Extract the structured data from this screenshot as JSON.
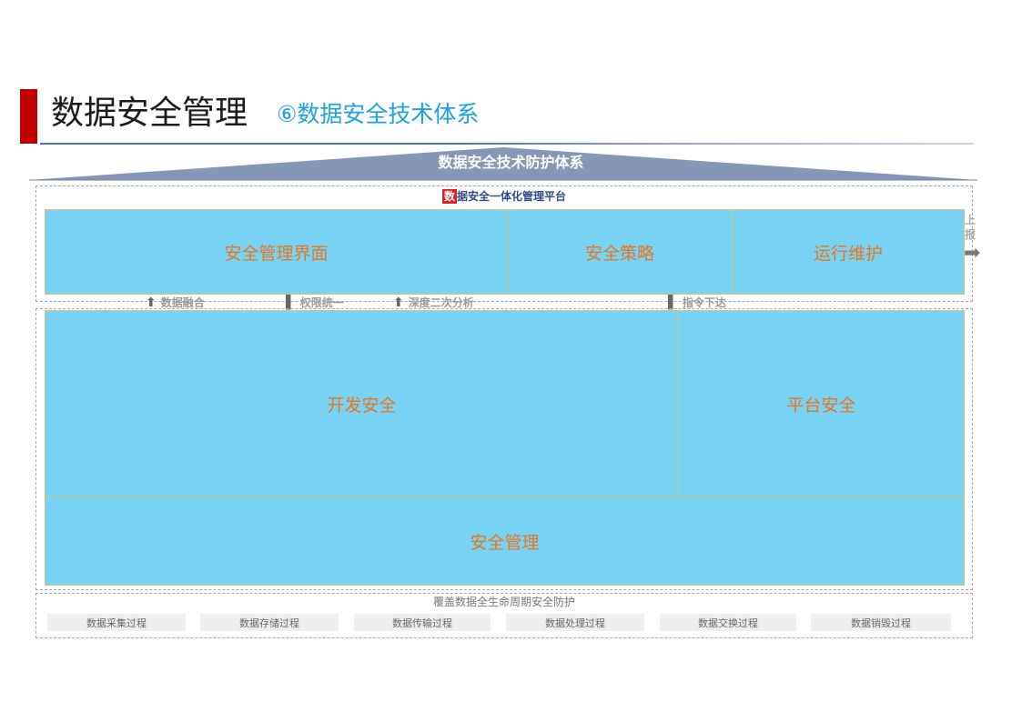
{
  "header": {
    "title": "数据安全管理",
    "subtitle": "⑥数据安全技术体系"
  },
  "roof": {
    "label": "数据安全技术防护体系"
  },
  "platform": {
    "label_first_char": "数",
    "label_rest": "据安全一体化管理平台",
    "cells": [
      "安全管理界面",
      "安全策略",
      "运行维护"
    ],
    "side_text": "上报"
  },
  "flows": [
    {
      "direction": "up",
      "label": "数据融合"
    },
    {
      "direction": "line",
      "label": "权限统一"
    },
    {
      "direction": "up",
      "label": "深度二次分析"
    },
    {
      "direction": "line",
      "label": "指令下达"
    }
  ],
  "security": {
    "dev": "开发安全",
    "platform": "平台安全",
    "management": "安全管理"
  },
  "lifecycle": {
    "label": "覆盖数据全生命周期安全防护",
    "stages": [
      "数据采集过程",
      "数据存储过程",
      "数据传输过程",
      "数据处理过程",
      "数据交换过程",
      "数据销毁过程"
    ]
  },
  "colors": {
    "accent_red": "#c00000",
    "subtitle_blue": "#1aa3e0",
    "roof": "#8597b5",
    "cell_fill": "#79d3f5",
    "cell_text": "#e8731c"
  }
}
